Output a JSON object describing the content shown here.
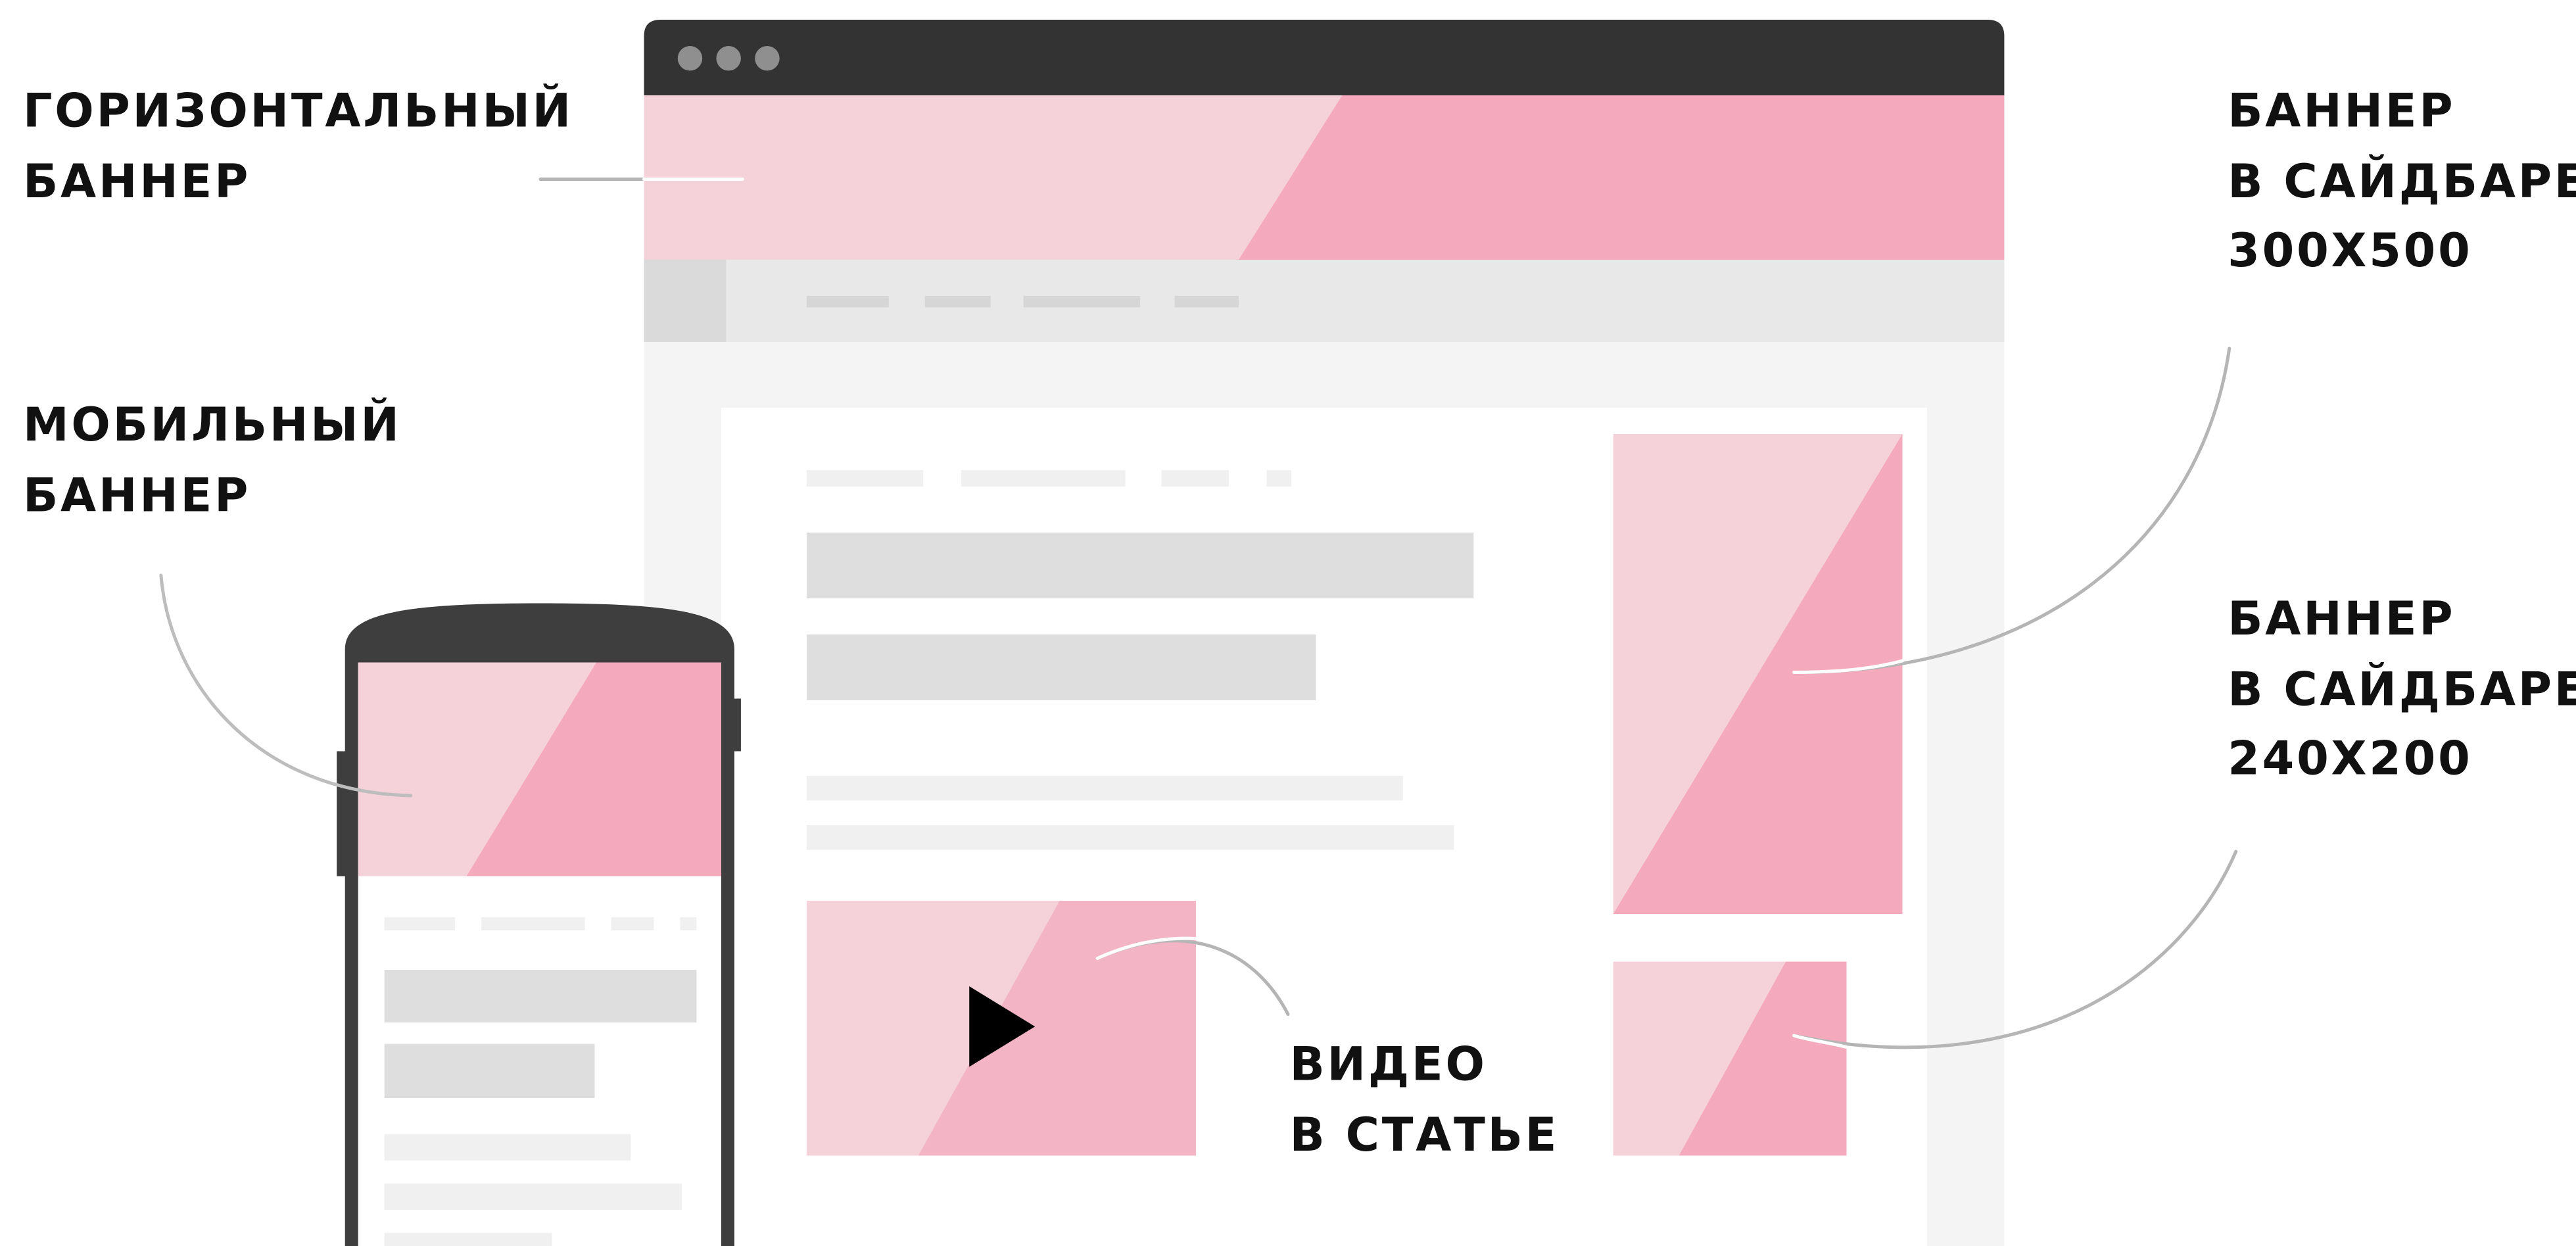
{
  "labels": {
    "horizontal_banner": {
      "line1": "ГОРИЗОНТАЛЬНЫЙ",
      "line2": "БАННЕР"
    },
    "mobile_banner": {
      "line1": "МОБИЛЬНЫЙ",
      "line2": "БАННЕР"
    },
    "sidebar_banner_large": {
      "line1": "БАННЕР",
      "line2": "В САЙДБАРЕ",
      "line3": "300X500"
    },
    "sidebar_banner_small": {
      "line1": "БАННЕР",
      "line2": "В САЙДБАРЕ",
      "line3": "240X200"
    },
    "in_article_video": {
      "line1": "ВИДЕО",
      "line2": "В СТАТЬЕ"
    }
  },
  "colors": {
    "banner_light": "#f5d2da",
    "banner_accent": "#f4aabc",
    "video_accent": "#f3b5c5",
    "browser_chrome": "#333333",
    "device_body": "#3e3e3e",
    "placeholder_bar": "#dedede",
    "callout_line": "#b5b5b5",
    "label_text": "#111111"
  },
  "icons": {
    "window_controls": "three-dots-icon",
    "video_play": "play-icon"
  }
}
